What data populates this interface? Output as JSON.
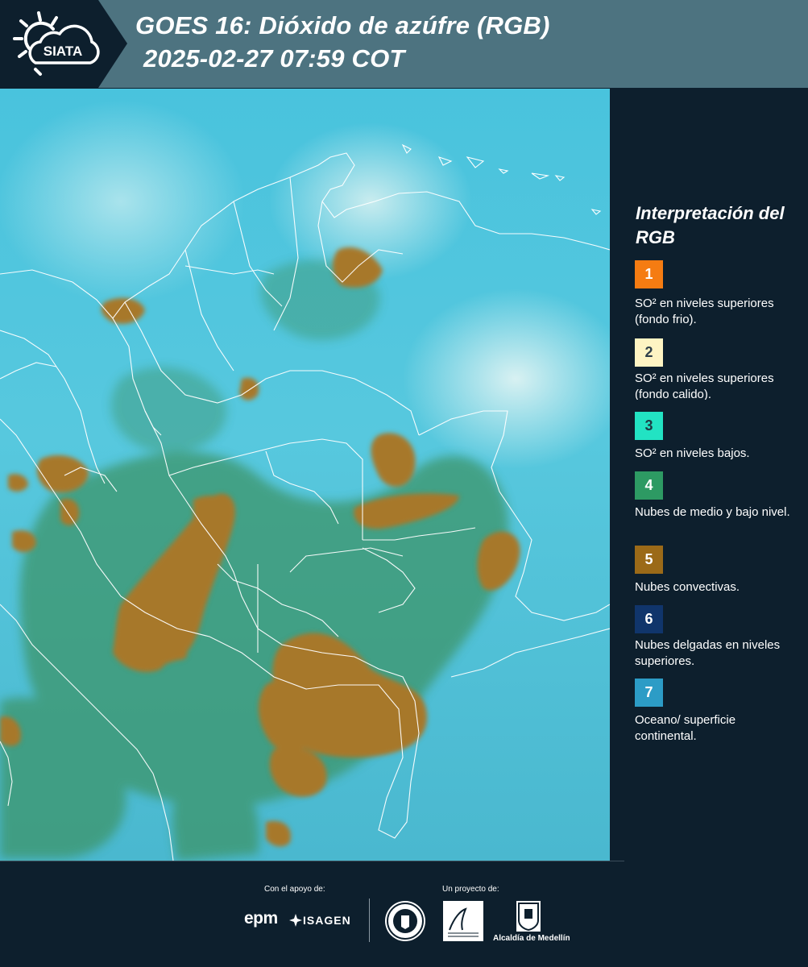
{
  "header": {
    "logo_text": "SIATA",
    "title_line1": "GOES 16: Dióxido de azúfre (RGB)",
    "title_line2": "2025-02-27 07:59 COT"
  },
  "legend": {
    "title": "Interpretación del RGB",
    "items": [
      {
        "number": "1",
        "text": "SO² en niveles superiores (fondo frio).",
        "color": "#f57c12",
        "text_color": "#ffffff"
      },
      {
        "number": "2",
        "text": "SO² en niveles superiores (fondo calido).",
        "color": "#fef4c3",
        "text_color": "#2f3f4a"
      },
      {
        "number": "3",
        "text": "SO² en niveles bajos.",
        "color": "#22e3c3",
        "text_color": "#1e3a44"
      },
      {
        "number": "4",
        "text": "Nubes de medio y bajo nivel.",
        "color": "#2d9a63",
        "text_color": "#ffffff"
      },
      {
        "number": "5",
        "text": "Nubes convectivas.",
        "color": "#9b6a18",
        "text_color": "#ffffff"
      },
      {
        "number": "6",
        "text": "Nubes delgadas en niveles superiores.",
        "color": "#10356b",
        "text_color": "#ffffff"
      },
      {
        "number": "7",
        "text": "Oceano/ superficie continental.",
        "color": "#2c9cc6",
        "text_color": "#ffffff"
      }
    ]
  },
  "footer": {
    "support_label": "Con el apoyo de:",
    "project_label": "Un proyecto de:",
    "sponsor1": "epm",
    "sponsor2": "ISAGEN",
    "partner_alcaldia": "Alcaldía de Medellín"
  },
  "colors": {
    "header_bg": "#4d7380",
    "page_bg": "#0d1f2d",
    "ocean": "#4fc3dc",
    "convective": "#a7782a",
    "vegetation": "#3f9a6a"
  }
}
